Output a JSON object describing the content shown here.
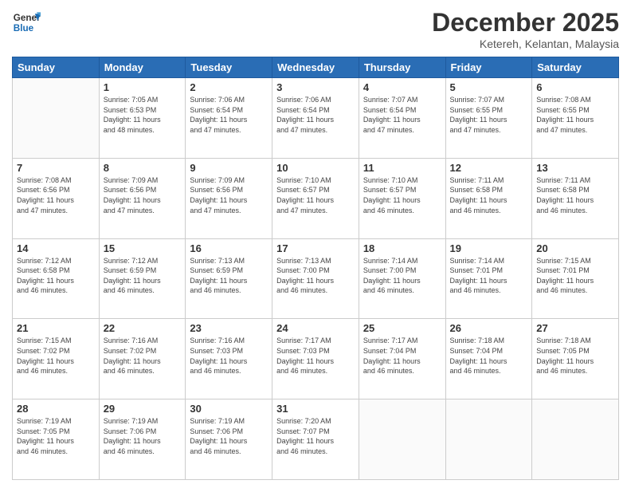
{
  "logo": {
    "line1": "General",
    "line2": "Blue"
  },
  "title": "December 2025",
  "subtitle": "Ketereh, Kelantan, Malaysia",
  "weekdays": [
    "Sunday",
    "Monday",
    "Tuesday",
    "Wednesday",
    "Thursday",
    "Friday",
    "Saturday"
  ],
  "weeks": [
    [
      {
        "day": "",
        "info": ""
      },
      {
        "day": "1",
        "info": "Sunrise: 7:05 AM\nSunset: 6:53 PM\nDaylight: 11 hours\nand 48 minutes."
      },
      {
        "day": "2",
        "info": "Sunrise: 7:06 AM\nSunset: 6:54 PM\nDaylight: 11 hours\nand 47 minutes."
      },
      {
        "day": "3",
        "info": "Sunrise: 7:06 AM\nSunset: 6:54 PM\nDaylight: 11 hours\nand 47 minutes."
      },
      {
        "day": "4",
        "info": "Sunrise: 7:07 AM\nSunset: 6:54 PM\nDaylight: 11 hours\nand 47 minutes."
      },
      {
        "day": "5",
        "info": "Sunrise: 7:07 AM\nSunset: 6:55 PM\nDaylight: 11 hours\nand 47 minutes."
      },
      {
        "day": "6",
        "info": "Sunrise: 7:08 AM\nSunset: 6:55 PM\nDaylight: 11 hours\nand 47 minutes."
      }
    ],
    [
      {
        "day": "7",
        "info": "Sunrise: 7:08 AM\nSunset: 6:56 PM\nDaylight: 11 hours\nand 47 minutes."
      },
      {
        "day": "8",
        "info": "Sunrise: 7:09 AM\nSunset: 6:56 PM\nDaylight: 11 hours\nand 47 minutes."
      },
      {
        "day": "9",
        "info": "Sunrise: 7:09 AM\nSunset: 6:56 PM\nDaylight: 11 hours\nand 47 minutes."
      },
      {
        "day": "10",
        "info": "Sunrise: 7:10 AM\nSunset: 6:57 PM\nDaylight: 11 hours\nand 47 minutes."
      },
      {
        "day": "11",
        "info": "Sunrise: 7:10 AM\nSunset: 6:57 PM\nDaylight: 11 hours\nand 46 minutes."
      },
      {
        "day": "12",
        "info": "Sunrise: 7:11 AM\nSunset: 6:58 PM\nDaylight: 11 hours\nand 46 minutes."
      },
      {
        "day": "13",
        "info": "Sunrise: 7:11 AM\nSunset: 6:58 PM\nDaylight: 11 hours\nand 46 minutes."
      }
    ],
    [
      {
        "day": "14",
        "info": "Sunrise: 7:12 AM\nSunset: 6:58 PM\nDaylight: 11 hours\nand 46 minutes."
      },
      {
        "day": "15",
        "info": "Sunrise: 7:12 AM\nSunset: 6:59 PM\nDaylight: 11 hours\nand 46 minutes."
      },
      {
        "day": "16",
        "info": "Sunrise: 7:13 AM\nSunset: 6:59 PM\nDaylight: 11 hours\nand 46 minutes."
      },
      {
        "day": "17",
        "info": "Sunrise: 7:13 AM\nSunset: 7:00 PM\nDaylight: 11 hours\nand 46 minutes."
      },
      {
        "day": "18",
        "info": "Sunrise: 7:14 AM\nSunset: 7:00 PM\nDaylight: 11 hours\nand 46 minutes."
      },
      {
        "day": "19",
        "info": "Sunrise: 7:14 AM\nSunset: 7:01 PM\nDaylight: 11 hours\nand 46 minutes."
      },
      {
        "day": "20",
        "info": "Sunrise: 7:15 AM\nSunset: 7:01 PM\nDaylight: 11 hours\nand 46 minutes."
      }
    ],
    [
      {
        "day": "21",
        "info": "Sunrise: 7:15 AM\nSunset: 7:02 PM\nDaylight: 11 hours\nand 46 minutes."
      },
      {
        "day": "22",
        "info": "Sunrise: 7:16 AM\nSunset: 7:02 PM\nDaylight: 11 hours\nand 46 minutes."
      },
      {
        "day": "23",
        "info": "Sunrise: 7:16 AM\nSunset: 7:03 PM\nDaylight: 11 hours\nand 46 minutes."
      },
      {
        "day": "24",
        "info": "Sunrise: 7:17 AM\nSunset: 7:03 PM\nDaylight: 11 hours\nand 46 minutes."
      },
      {
        "day": "25",
        "info": "Sunrise: 7:17 AM\nSunset: 7:04 PM\nDaylight: 11 hours\nand 46 minutes."
      },
      {
        "day": "26",
        "info": "Sunrise: 7:18 AM\nSunset: 7:04 PM\nDaylight: 11 hours\nand 46 minutes."
      },
      {
        "day": "27",
        "info": "Sunrise: 7:18 AM\nSunset: 7:05 PM\nDaylight: 11 hours\nand 46 minutes."
      }
    ],
    [
      {
        "day": "28",
        "info": "Sunrise: 7:19 AM\nSunset: 7:05 PM\nDaylight: 11 hours\nand 46 minutes."
      },
      {
        "day": "29",
        "info": "Sunrise: 7:19 AM\nSunset: 7:06 PM\nDaylight: 11 hours\nand 46 minutes."
      },
      {
        "day": "30",
        "info": "Sunrise: 7:19 AM\nSunset: 7:06 PM\nDaylight: 11 hours\nand 46 minutes."
      },
      {
        "day": "31",
        "info": "Sunrise: 7:20 AM\nSunset: 7:07 PM\nDaylight: 11 hours\nand 46 minutes."
      },
      {
        "day": "",
        "info": ""
      },
      {
        "day": "",
        "info": ""
      },
      {
        "day": "",
        "info": ""
      }
    ]
  ]
}
